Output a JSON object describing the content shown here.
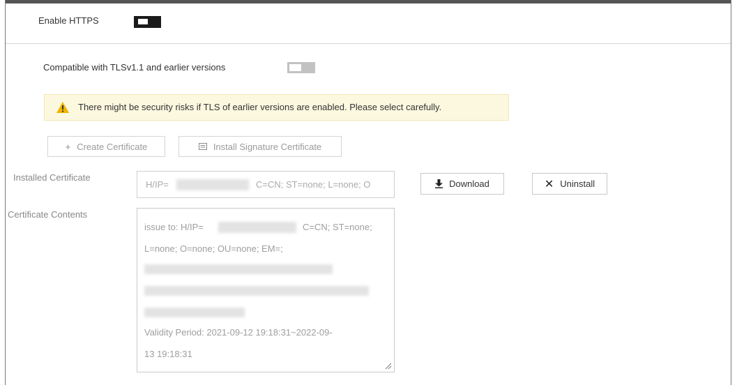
{
  "https": {
    "label": "Enable HTTPS",
    "enabled": true
  },
  "tls": {
    "label": "Compatible with TLSv1.1 and earlier versions",
    "enabled": false
  },
  "warning": {
    "icon": "warning-triangle-icon",
    "text": "There might be security risks if TLS of earlier versions are enabled. Please select carefully."
  },
  "actions": {
    "create_certificate": "Create Certificate",
    "install_signature_certificate": "Install Signature Certificate"
  },
  "installed_certificate": {
    "label": "Installed Certificate",
    "prefix": "H/IP=",
    "suffix": "C=CN; ST=none; L=none; O"
  },
  "buttons": {
    "download": "Download",
    "uninstall": "Uninstall"
  },
  "certificate_contents": {
    "label": "Certificate Contents",
    "issue_prefix": "issue to: H/IP=",
    "issue_suffix": "C=CN; ST=none;",
    "line2": "L=none; O=none; OU=none; EM=;",
    "validity_line1": "Validity Period: 2021-09-12 19:18:31~2022-09-",
    "validity_line2": "13 19:18:31"
  },
  "colors": {
    "toggle_on": "#1a1a1a",
    "toggle_off": "#c2c2c2",
    "warning_bg": "#fcf8e0",
    "warning_icon": "#f0b400"
  }
}
